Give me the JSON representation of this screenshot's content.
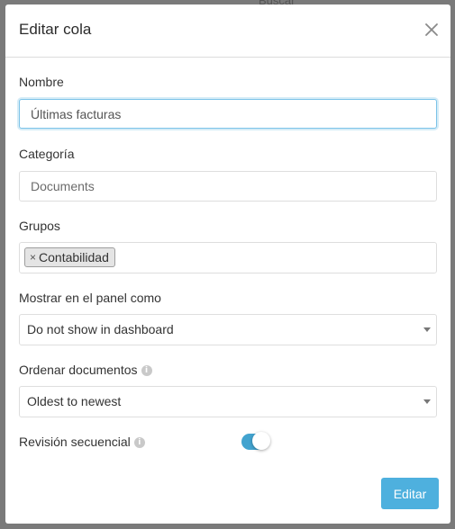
{
  "background": {
    "search_hint": "Buscar"
  },
  "modal": {
    "title": "Editar cola",
    "fields": {
      "name": {
        "label": "Nombre",
        "value": "Últimas facturas"
      },
      "category": {
        "label": "Categoría",
        "placeholder": "Documents"
      },
      "groups": {
        "label": "Grupos",
        "tags": [
          "Contabilidad"
        ],
        "remove_symbol": "×"
      },
      "dashboard": {
        "label": "Mostrar en el panel como",
        "selected": "Do not show in dashboard"
      },
      "order": {
        "label": "Ordenar documentos",
        "selected": "Oldest to newest"
      },
      "sequential_review": {
        "label": "Revisión secuencial",
        "enabled": true
      }
    },
    "info_icon_glyph": "i",
    "submit_label": "Editar"
  },
  "colors": {
    "accent": "#42a3cf",
    "button": "#4eb0de",
    "focus_border": "#7cc3e8"
  }
}
